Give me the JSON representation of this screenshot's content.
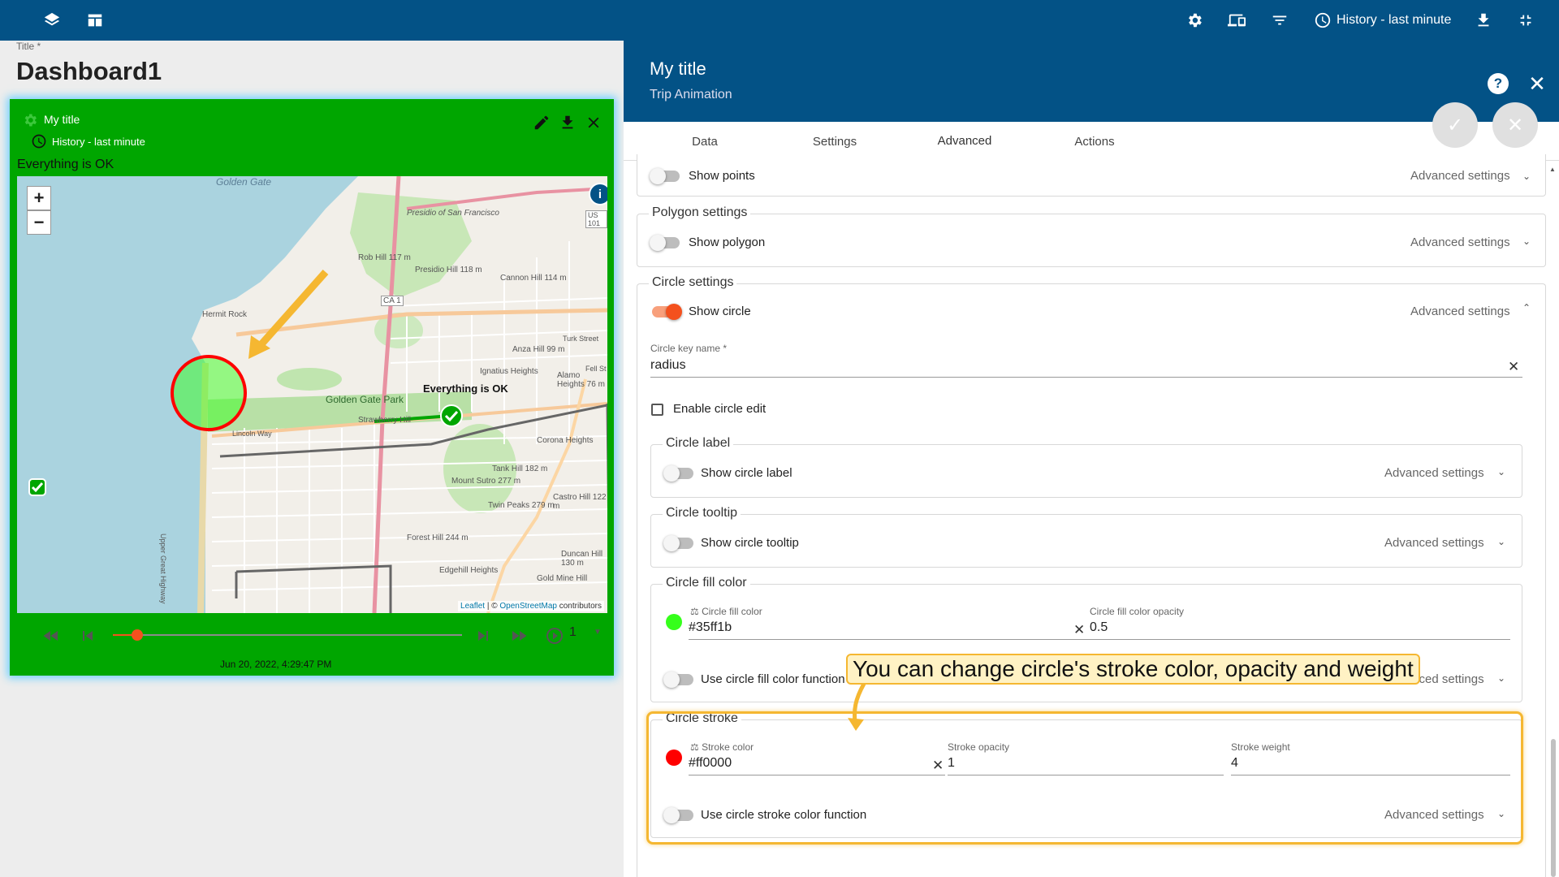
{
  "topbar": {
    "history_label": "History - last minute"
  },
  "dashboard": {
    "title_label": "Title *",
    "title": "Dashboard1"
  },
  "widget": {
    "title": "My title",
    "subtitle": "History - last minute",
    "status_text": "Everything is OK",
    "background_color": "#00a600",
    "map": {
      "zoom_in": "+",
      "zoom_out": "−",
      "info": "i",
      "marker_label": "Everything is OK",
      "attribution_leaflet": "Leaflet",
      "attribution_sep": " | © ",
      "attribution_osm": "OpenStreetMap",
      "attribution_tail": " contributors",
      "labels": [
        "Golden Gate",
        "Presidio of San Francisco",
        "Rob Hill 117 m",
        "Presidio Hill 118 m",
        "Cannon Hill 114 m",
        "Hermit Rock",
        "CA 1",
        "Anza Hill 99 m",
        "Ignatius Heights",
        "Alamo Heights 76 m",
        "Golden Gate Park",
        "Strawberry Hill",
        "Lincoln Way",
        "Corona Heights",
        "Tank Hill 182 m",
        "Mount Sutro 277 m",
        "Twin Peaks 279 m",
        "Castro Hill 122 m",
        "Forest Hill 244 m",
        "Edgehill Heights",
        "Duncan Hill 130 m",
        "Gold Mine Hill",
        "Upper Great Highway",
        "Turk Street",
        "Fell St",
        "US 101"
      ]
    },
    "player": {
      "timestamp": "Jun 20, 2022, 4:29:47 PM",
      "speed": "1",
      "progress": 0.07
    }
  },
  "panel": {
    "title": "My title",
    "subtitle": "Trip Animation",
    "help": "?",
    "tabs": [
      {
        "label": "Data",
        "active": false
      },
      {
        "label": "Settings",
        "active": false
      },
      {
        "label": "Advanced",
        "active": true
      },
      {
        "label": "Actions",
        "active": false
      }
    ],
    "points": {
      "toggle_label": "Show points",
      "advanced": "Advanced settings",
      "on": false
    },
    "polygon": {
      "legend": "Polygon settings",
      "toggle_label": "Show polygon",
      "advanced": "Advanced settings",
      "on": false
    },
    "circle": {
      "legend": "Circle settings",
      "toggle_label": "Show circle",
      "advanced": "Advanced settings",
      "on": true,
      "key_name_label": "Circle key name *",
      "key_name_value": "radius",
      "enable_edit_label": "Enable circle edit",
      "label_section": {
        "legend": "Circle label",
        "toggle_label": "Show circle label",
        "advanced": "Advanced settings"
      },
      "tooltip_section": {
        "legend": "Circle tooltip",
        "toggle_label": "Show circle tooltip",
        "advanced": "Advanced settings"
      },
      "fill_section": {
        "legend": "Circle fill color",
        "color_label": "Circle fill color",
        "color_value": "#35ff1b",
        "opacity_label": "Circle fill color opacity",
        "opacity_value": "0.5",
        "function_label": "Use circle fill color function",
        "advanced": "Advanced settings",
        "swatch_color": "#35ff1b"
      },
      "stroke_section": {
        "legend": "Circle stroke",
        "color_label": "Stroke color",
        "color_value": "#ff0000",
        "opacity_label": "Stroke opacity",
        "opacity_value": "1",
        "weight_label": "Stroke weight",
        "weight_value": "4",
        "function_label": "Use circle stroke color function",
        "advanced": "Advanced settings",
        "swatch_color": "#ff0000"
      }
    },
    "callout": "You can change circle's stroke color, opacity and weight"
  },
  "colors": {
    "primary": "#035286",
    "accent": "#f4511e",
    "highlight": "#f5b731"
  }
}
